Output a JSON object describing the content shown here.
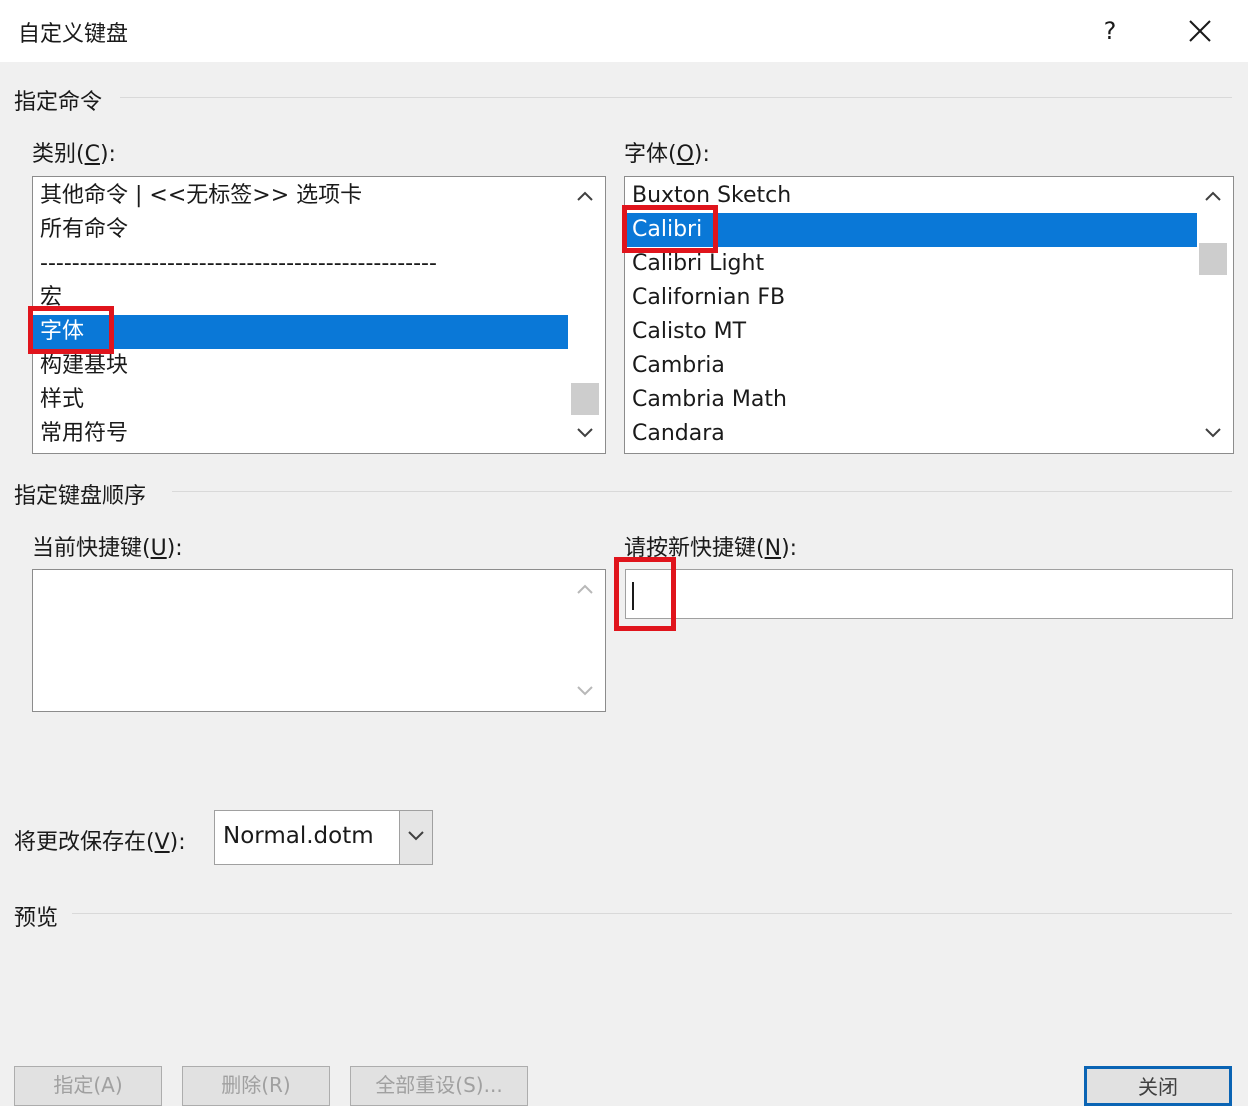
{
  "dialog": {
    "title": "自定义键盘",
    "help_label": "?"
  },
  "command_group": {
    "label": "指定命令"
  },
  "categories": {
    "label_prefix": "类别(",
    "label_key": "C",
    "label_suffix": "):",
    "items": [
      {
        "label": "其他命令 | <<无标签>> 选项卡"
      },
      {
        "label": "所有命令"
      },
      {
        "label": "--------------------------------------------------"
      },
      {
        "label": "宏"
      },
      {
        "label": "字体"
      },
      {
        "label": "构建基块"
      },
      {
        "label": "样式"
      },
      {
        "label": "常用符号"
      }
    ],
    "selected": "字体"
  },
  "fonts": {
    "label_prefix": "字体(",
    "label_key": "O",
    "label_suffix": "):",
    "items": [
      {
        "label": "Buxton Sketch"
      },
      {
        "label": "Calibri"
      },
      {
        "label": "Calibri Light"
      },
      {
        "label": "Californian FB"
      },
      {
        "label": "Calisto MT"
      },
      {
        "label": "Cambria"
      },
      {
        "label": "Cambria Math"
      },
      {
        "label": "Candara"
      }
    ],
    "selected": "Calibri"
  },
  "keyboard_group": {
    "label": "指定键盘顺序"
  },
  "current_keys": {
    "label_prefix": "当前快捷键(",
    "label_key": "U",
    "label_suffix": "):"
  },
  "new_key": {
    "label_prefix": "请按新快捷键(",
    "label_key": "N",
    "label_suffix": "):",
    "value": ""
  },
  "save_in": {
    "label_prefix": "将更改保存在(",
    "label_key": "V",
    "label_suffix": "):",
    "value": "Normal.dotm"
  },
  "preview_group": {
    "label": "预览"
  },
  "buttons": {
    "assign": "指定(A)",
    "remove": "删除(R)",
    "reset_all": "全部重设(S)...",
    "close": "关闭"
  },
  "colors": {
    "selection": "#0a78d7",
    "highlight_box": "#e0141c"
  }
}
